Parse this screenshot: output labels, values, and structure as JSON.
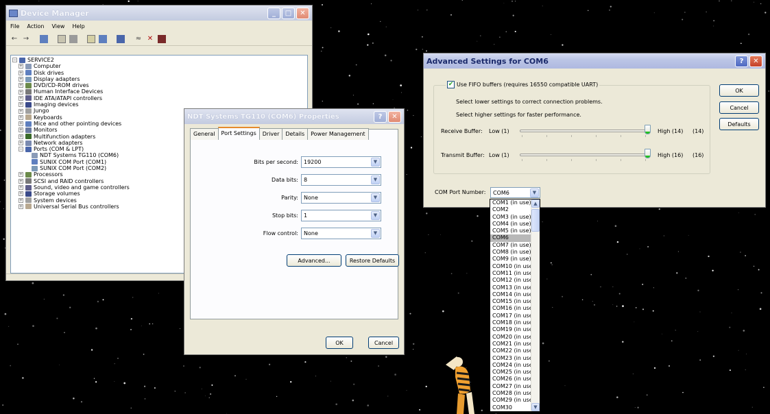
{
  "device_manager": {
    "title": "Device Manager",
    "menu": [
      "File",
      "Action",
      "View",
      "Help"
    ],
    "toolbar_icons": [
      "back-icon",
      "forward-icon",
      "device-view-icon",
      "properties-icon",
      "print-icon",
      "help-icon",
      "resources-icon",
      "computer-icon",
      "scan-hardware-icon",
      "uninstall-icon",
      "disable-icon"
    ],
    "tree": [
      {
        "label": "SERVICE2",
        "expander": "−",
        "indent": 0,
        "icon": "computer-icon"
      },
      {
        "label": "Computer",
        "expander": "+",
        "indent": 1,
        "icon": "computer-icon"
      },
      {
        "label": "Disk drives",
        "expander": "+",
        "indent": 1,
        "icon": "disk-drive-icon"
      },
      {
        "label": "Display adapters",
        "expander": "+",
        "indent": 1,
        "icon": "display-adapter-icon"
      },
      {
        "label": "DVD/CD-ROM drives",
        "expander": "+",
        "indent": 1,
        "icon": "dvd-drive-icon"
      },
      {
        "label": "Human Interface Devices",
        "expander": "+",
        "indent": 1,
        "icon": "hid-icon"
      },
      {
        "label": "IDE ATA/ATAPI controllers",
        "expander": "+",
        "indent": 1,
        "icon": "ide-controller-icon"
      },
      {
        "label": "Imaging devices",
        "expander": "+",
        "indent": 1,
        "icon": "camera-icon"
      },
      {
        "label": "Jungo",
        "expander": "+",
        "indent": 1,
        "icon": "chip-icon"
      },
      {
        "label": "Keyboards",
        "expander": "+",
        "indent": 1,
        "icon": "keyboard-icon"
      },
      {
        "label": "Mice and other pointing devices",
        "expander": "+",
        "indent": 1,
        "icon": "mouse-icon"
      },
      {
        "label": "Monitors",
        "expander": "+",
        "indent": 1,
        "icon": "monitor-icon"
      },
      {
        "label": "Multifunction adapters",
        "expander": "+",
        "indent": 1,
        "icon": "multifunction-icon"
      },
      {
        "label": "Network adapters",
        "expander": "+",
        "indent": 1,
        "icon": "network-adapter-icon"
      },
      {
        "label": "Ports (COM & LPT)",
        "expander": "−",
        "indent": 1,
        "icon": "port-icon"
      },
      {
        "label": "NDT Systems TG110 (COM6)",
        "expander": "",
        "indent": 2,
        "icon": "port-icon"
      },
      {
        "label": "SUNIX COM Port (COM1)",
        "expander": "",
        "indent": 2,
        "icon": "port-icon"
      },
      {
        "label": "SUNIX COM Port (COM2)",
        "expander": "",
        "indent": 2,
        "icon": "port-icon"
      },
      {
        "label": "Processors",
        "expander": "+",
        "indent": 1,
        "icon": "processor-icon"
      },
      {
        "label": "SCSI and RAID controllers",
        "expander": "+",
        "indent": 1,
        "icon": "scsi-icon"
      },
      {
        "label": "Sound, video and game controllers",
        "expander": "+",
        "indent": 1,
        "icon": "sound-icon"
      },
      {
        "label": "Storage volumes",
        "expander": "+",
        "indent": 1,
        "icon": "storage-icon"
      },
      {
        "label": "System devices",
        "expander": "+",
        "indent": 1,
        "icon": "system-icon"
      },
      {
        "label": "Universal Serial Bus controllers",
        "expander": "+",
        "indent": 1,
        "icon": "usb-icon"
      }
    ]
  },
  "properties": {
    "title": "NDT Systems TG110 (COM6) Properties",
    "tabs": [
      "General",
      "Port Settings",
      "Driver",
      "Details",
      "Power Management"
    ],
    "selected_tab": "Port Settings",
    "fields": [
      {
        "label": "Bits per second:",
        "value": "19200"
      },
      {
        "label": "Data bits:",
        "value": "8"
      },
      {
        "label": "Parity:",
        "value": "None"
      },
      {
        "label": "Stop bits:",
        "value": "1"
      },
      {
        "label": "Flow control:",
        "value": "None"
      }
    ],
    "advanced_button": "Advanced...",
    "restore_button": "Restore Defaults",
    "ok_button": "OK",
    "cancel_button": "Cancel"
  },
  "advanced": {
    "title": "Advanced Settings for COM6",
    "fifo_label": "Use FIFO buffers (requires 16550 compatible UART)",
    "fifo_checked": true,
    "hint_lower": "Select lower settings to correct connection problems.",
    "hint_higher": "Select higher settings for faster performance.",
    "receive": {
      "label": "Receive Buffer:",
      "low": "Low (1)",
      "high": "High (14)",
      "value": "(14)",
      "level": 1.0
    },
    "transmit": {
      "label": "Transmit Buffer:",
      "low": "Low (1)",
      "high": "High (16)",
      "value": "(16)",
      "level": 1.0
    },
    "com_port_label": "COM Port Number:",
    "com_port_value": "COM6",
    "ok_button": "OK",
    "cancel_button": "Cancel",
    "defaults_button": "Defaults",
    "com_port_options": [
      "COM1 (in use)",
      "COM2",
      "COM3 (in use)",
      "COM4 (in use)",
      "COM5 (in use)",
      "COM6",
      "COM7 (in use)",
      "COM8 (in use)",
      "COM9 (in use)",
      "COM10 (in use",
      "COM11 (in use",
      "COM12 (in use",
      "COM13 (in use",
      "COM14 (in use",
      "COM15 (in use",
      "COM16 (in use",
      "COM17 (in use",
      "COM18 (in use",
      "COM19 (in use",
      "COM20 (in use",
      "COM21 (in use",
      "COM22 (in use",
      "COM23 (in use",
      "COM24 (in use",
      "COM25 (in use",
      "COM26 (in use",
      "COM27 (in use",
      "COM28 (in use",
      "COM29 (in use",
      "COM30"
    ],
    "selected_option": "COM6"
  }
}
